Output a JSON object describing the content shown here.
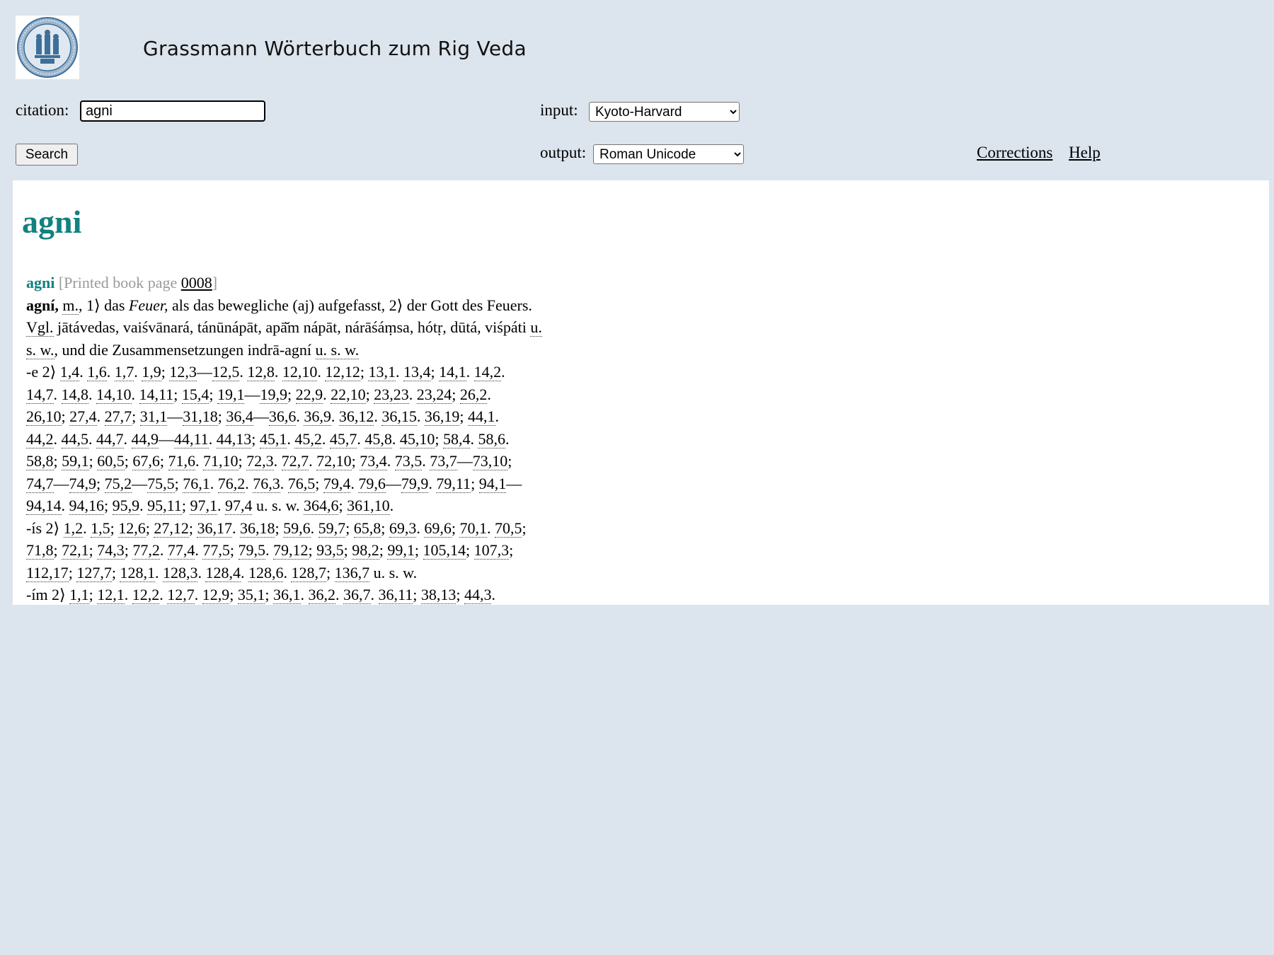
{
  "header": {
    "title": "Grassmann Wörterbuch zum Rig Veda"
  },
  "form": {
    "citation_label": "citation:",
    "citation_value": "agni",
    "input_label": "input:",
    "input_selected": "Kyoto-Harvard",
    "output_label": "output:",
    "output_selected": "Roman Unicode",
    "search_label": "Search"
  },
  "links": {
    "corrections": "Corrections",
    "help": "Help"
  },
  "entry": {
    "heading": "agni",
    "headword": "agni",
    "printed_page_label": "[Printed book page ",
    "printed_page_number": "0008",
    "printed_page_close": "]",
    "lemma": "agní,",
    "gender": "m.",
    "def_1": ", 1⟩ das ",
    "def_feuer": "Feuer,",
    "def_2": " als das bewegliche (aj) aufgefasst, 2⟩ der Gott des Feuers.",
    "vgl": "Vgl.",
    "vgl_list": " jātávedas, vaiśvānará, tánūnápāt, apā̆m nápāt, nárāśáṃsa, hótṛ, dūtá, viśpáti ",
    "usw_1": "u.",
    "usw_2": "s. w.",
    "composita": ", und die Zusammensetzungen indrā-agní ",
    "usw_3": "u. s. w.",
    "form_e": "-e 2⟩",
    "form_is": "-ís 2⟩",
    "form_im": "-ím 2⟩",
    "end_usw": "u. s. w."
  },
  "refs": {
    "e_line1": [
      "1,4",
      "1,6",
      "1,7",
      "1,9",
      "12,3",
      "12,5",
      "12,8",
      "12,10",
      "12,12",
      "13,1",
      "13,4",
      "14,1",
      "14,2"
    ],
    "e_line2": [
      "14,7",
      "14,8",
      "14,10",
      "14,11",
      "15,4",
      "19,1",
      "19,9",
      "22,9",
      "22,10",
      "23,23",
      "23,24",
      "26,2"
    ],
    "e_line3": [
      "26,10",
      "27,4",
      "27,7",
      "31,1",
      "31,18",
      "36,4",
      "36,6",
      "36,9",
      "36,12",
      "36,15",
      "36,19",
      "44,1"
    ],
    "e_line4": [
      "44,2",
      "44,5",
      "44,7",
      "44,9",
      "44,11",
      "44,13",
      "45,1",
      "45,2",
      "45,7",
      "45,8",
      "45,10",
      "58,4",
      "58,6"
    ],
    "e_line5": [
      "58,8",
      "59,1",
      "60,5",
      "67,6",
      "71,6",
      "71,10",
      "72,3",
      "72,7",
      "72,10",
      "73,4",
      "73,5",
      "73,7",
      "73,10"
    ],
    "e_line6": [
      "74,7",
      "74,9",
      "75,2",
      "75,5",
      "76,1",
      "76,2",
      "76,3",
      "76,5",
      "79,4",
      "79,6",
      "79,9",
      "79,11",
      "94,1"
    ],
    "e_line7": [
      "94,14",
      "94,16",
      "95,9",
      "95,11",
      "97,1",
      "97,4",
      "364,6",
      "361,10"
    ],
    "is_line1": [
      "1,2",
      "1,5",
      "12,6",
      "27,12",
      "36,17",
      "36,18",
      "59,6",
      "59,7",
      "65,8",
      "69,3",
      "69,6",
      "70,1",
      "70,5"
    ],
    "is_line2": [
      "71,8",
      "72,1",
      "74,3",
      "77,2",
      "77,4",
      "77,5",
      "79,5",
      "79,12",
      "93,5",
      "98,2",
      "99,1",
      "105,14",
      "107,3"
    ],
    "is_line3": [
      "112,17",
      "127,7",
      "128,1",
      "128,3",
      "128,4",
      "128,6",
      "128,7",
      "136,7"
    ],
    "im_line1": [
      "1,1",
      "12,1",
      "12,2",
      "12,7",
      "12,9",
      "35,1",
      "36,1",
      "36,2",
      "36,7",
      "36,11",
      "38,13",
      "44,3"
    ]
  },
  "separators": {
    "e_line1": [
      ". ",
      ". ",
      ". ",
      "; ",
      "—",
      ". ",
      ". ",
      ". ",
      "; ",
      ". ",
      "; ",
      ". ",
      "."
    ],
    "e_line2": [
      ". ",
      ". ",
      ". ",
      "; ",
      "; ",
      "—",
      "; ",
      ". ",
      "; ",
      ". ",
      "; ",
      "."
    ],
    "e_line3": [
      "; ",
      ". ",
      "; ",
      "—",
      "; ",
      "—",
      ". ",
      ". ",
      ". ",
      ". ",
      "; ",
      "."
    ],
    "e_line4": [
      ". ",
      ". ",
      ". ",
      "—",
      ". ",
      "; ",
      ". ",
      ". ",
      ". ",
      ". ",
      "; ",
      ". ",
      "."
    ],
    "e_line5": [
      "; ",
      "; ",
      "; ",
      "; ",
      ". ",
      "; ",
      ". ",
      ". ",
      "; ",
      ". ",
      ". ",
      "—",
      ";"
    ],
    "e_line6": [
      "—",
      "; ",
      "—",
      "; ",
      ". ",
      ". ",
      ". ",
      "; ",
      ". ",
      "—",
      ". ",
      "; ",
      "—"
    ],
    "e_line7": [
      ". ",
      "; ",
      ". ",
      "; ",
      ". ",
      " ",
      "; ",
      "."
    ],
    "is_line1": [
      ". ",
      "; ",
      "; ",
      "; ",
      ". ",
      "; ",
      ". ",
      "; ",
      "; ",
      ". ",
      "; ",
      ". ",
      ";"
    ],
    "is_line2": [
      "; ",
      "; ",
      "; ",
      ". ",
      ". ",
      "; ",
      ". ",
      "; ",
      "; ",
      "; ",
      "; ",
      "; ",
      ";"
    ],
    "is_line3": [
      "; ",
      "; ",
      ". ",
      ". ",
      ". ",
      ". ",
      "; ",
      " "
    ],
    "im_line1": [
      "; ",
      ". ",
      ". ",
      ". ",
      "; ",
      "; ",
      ". ",
      ". ",
      ". ",
      "; ",
      "; ",
      "."
    ]
  }
}
